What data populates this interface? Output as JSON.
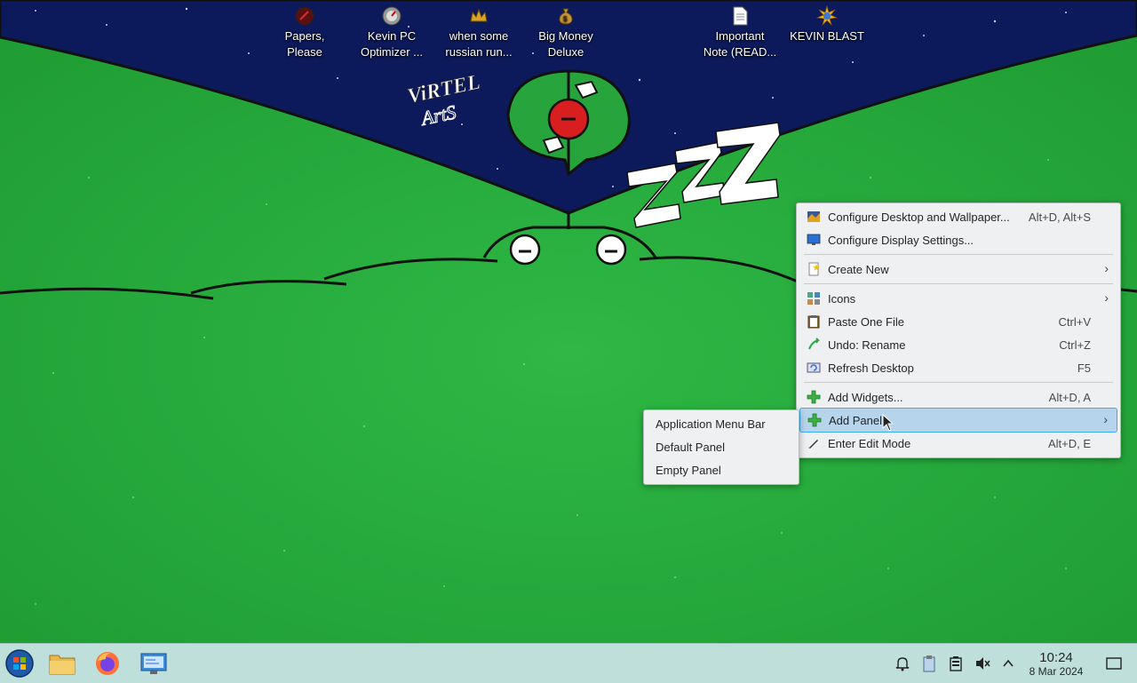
{
  "desktop": {
    "icons": [
      {
        "id": "papers-please",
        "label": "Papers,\nPlease",
        "icon": "seal-icon"
      },
      {
        "id": "kevin-pc-optimizer",
        "label": "Kevin PC\nOptimizer ...",
        "icon": "gauge-icon"
      },
      {
        "id": "russian-run",
        "label": "when some\nrussian run...",
        "icon": "crown-icon"
      },
      {
        "id": "big-money-deluxe",
        "label": "Big Money\nDeluxe",
        "icon": "money-bag-icon"
      },
      {
        "id": "important-note",
        "label": "Important\nNote (READ...",
        "icon": "document-icon"
      },
      {
        "id": "kevin-blast",
        "label": "KEVIN BLAST",
        "icon": "blast-icon"
      }
    ],
    "wallpaper_logo": "ViRTEL\nArtS"
  },
  "context_menu": {
    "items": [
      {
        "label": "Configure Desktop and Wallpaper...",
        "shortcut": "Alt+D, Alt+S",
        "icon": "palette-icon"
      },
      {
        "label": "Configure Display Settings...",
        "shortcut": "",
        "icon": "monitor-icon"
      },
      {
        "label": "Create New",
        "shortcut": "",
        "icon": "new-file-icon",
        "submenu": true
      },
      {
        "label": "Icons",
        "shortcut": "",
        "icon": "icons-grid-icon",
        "submenu": true
      },
      {
        "label": "Paste One File",
        "shortcut": "Ctrl+V",
        "icon": "paste-icon"
      },
      {
        "label": "Undo: Rename",
        "shortcut": "Ctrl+Z",
        "icon": "undo-icon"
      },
      {
        "label": "Refresh Desktop",
        "shortcut": "F5",
        "icon": "refresh-icon"
      },
      {
        "label": "Add Widgets...",
        "shortcut": "Alt+D, A",
        "icon": "add-icon"
      },
      {
        "label": "Add Panel",
        "shortcut": "",
        "icon": "add-icon",
        "submenu": true,
        "highlighted": true
      },
      {
        "label": "Enter Edit Mode",
        "shortcut": "Alt+D, E",
        "icon": "edit-icon"
      }
    ]
  },
  "submenu": {
    "items": [
      "Application Menu Bar",
      "Default Panel",
      "Empty Panel"
    ]
  },
  "taskbar": {
    "apps": [
      "start-menu-icon",
      "file-manager-icon",
      "firefox-icon",
      "system-settings-icon"
    ],
    "tray": [
      "notifications-icon",
      "clipboard-icon",
      "battery-icon",
      "volume-muted-icon",
      "chevron-up-icon",
      "show-desktop-icon"
    ],
    "clock": {
      "time": "10:24",
      "date": "8 Mar 2024"
    }
  },
  "colors": {
    "accent": "#3daee9",
    "menu_highlight": "#b6d4ec",
    "taskbar": "#bfe0da",
    "wallpaper_green": "#25a63a",
    "night_sky": "#0c1a5c"
  }
}
